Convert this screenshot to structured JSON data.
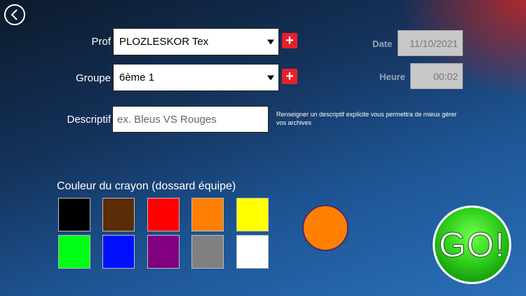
{
  "form": {
    "prof_label": "Prof",
    "prof_value": "PLOZLESKOR Tex",
    "groupe_label": "Groupe",
    "groupe_value": "6ème 1",
    "add_symbol": "+",
    "descriptif_label": "Descriptif",
    "descriptif_placeholder": "ex. Bleus VS Rouges",
    "descriptif_hint": "Renseigner un descriptif explicite vous permettra de mieux gérer vos archives"
  },
  "meta": {
    "date_label": "Date",
    "date_value": "11/10/2021",
    "heure_label": "Heure",
    "heure_value": "00:02"
  },
  "colors": {
    "title": "Couleur du crayon (dossard équipe)",
    "swatches": [
      "#000000",
      "#5c2c06",
      "#ff0000",
      "#ff7f00",
      "#ffff00",
      "#00ff14",
      "#0010ff",
      "#800080",
      "#808080",
      "#ffffff"
    ],
    "selected": "#ff7f00"
  },
  "go_label": "GO!"
}
